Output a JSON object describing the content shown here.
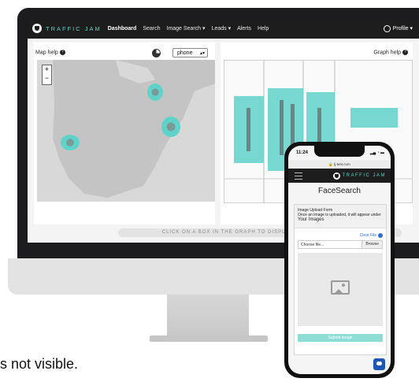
{
  "desktop": {
    "brand": "TRAFFIC JAM",
    "nav": {
      "dashboard": "Dashboard",
      "search": "Search",
      "image_search": "Image Search ▾",
      "leads": "Leads ▾",
      "alerts": "Alerts",
      "help": "Help",
      "profile": "Profile ▾"
    },
    "map": {
      "help_label": "Map help",
      "zoom_in": "+",
      "zoom_out": "−"
    },
    "filter": {
      "selected": "phone"
    },
    "graph": {
      "help_label": "Graph help"
    },
    "hint": "CLICK ON A BOX IN THE GRAPH TO DISPLAY THE DETAILS OF THE"
  },
  "phone": {
    "status_time": "11:24",
    "url": "tj-test.com",
    "brand": "TRAFFIC JAM",
    "title": "FaceSearch",
    "form_title": "Image Upload Form",
    "form_note": "Once an image is uploaded, it will appear under",
    "form_note_big": "Your Images",
    "clear_file": "Clear File",
    "file_placeholder": "Choose file...",
    "browse": "Browse",
    "submit": "Submit Image"
  },
  "caption": "s not visible.",
  "colors": {
    "accent": "#5fd3c9",
    "nav_bg": "#1d1d1d",
    "link": "#2a6fd1",
    "chat": "#1f57b5"
  }
}
